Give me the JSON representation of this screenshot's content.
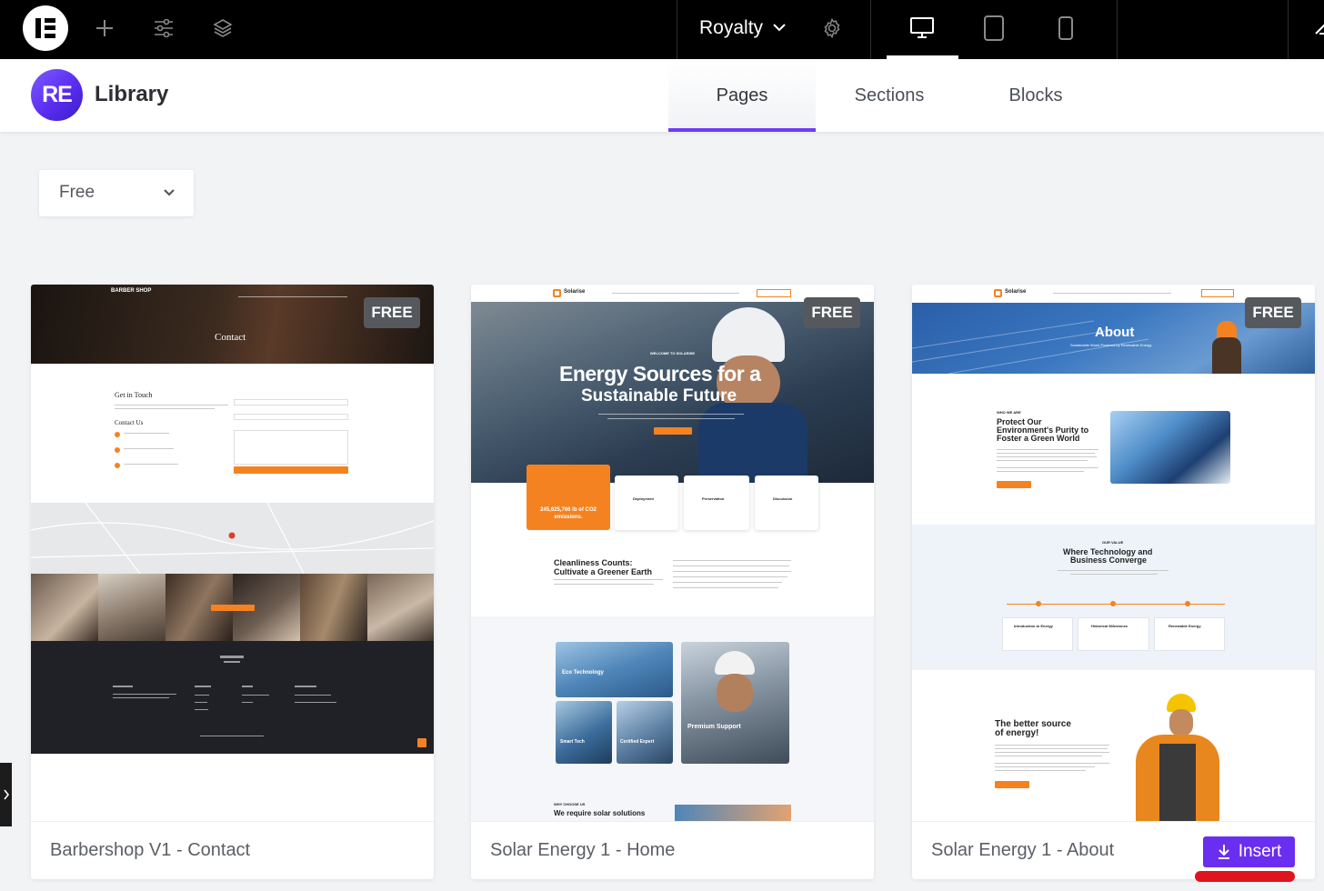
{
  "topbar": {
    "site_name": "Royalty",
    "icons": [
      "elementor-logo-icon",
      "add-icon",
      "settings-sliders-icon",
      "layers-icon",
      "gear-icon",
      "desktop-icon",
      "tablet-icon",
      "mobile-icon"
    ]
  },
  "library": {
    "logo_text": "RE",
    "title": "Library",
    "tabs": [
      {
        "label": "Pages",
        "active": true
      },
      {
        "label": "Sections",
        "active": false
      },
      {
        "label": "Blocks",
        "active": false
      }
    ],
    "filter": {
      "selected": "Free"
    }
  },
  "cards": [
    {
      "title": "Barbershop V1 - Contact",
      "badge": "FREE",
      "thumb": {
        "brand": "BARBER SHOP",
        "hero": "Contact",
        "get_in_touch": "Get in Touch",
        "contact_us": "Contact Us"
      }
    },
    {
      "title": "Solar Energy 1 - Home",
      "badge": "FREE",
      "thumb": {
        "brand": "Solarise",
        "welcome": "WELCOME TO SOLARISE",
        "hero_line1": "Energy Sources for a",
        "hero_line2": "Sustainable Future",
        "stat_text": "245,625,766 lb of CO2 emissions.",
        "features": [
          "Deployment",
          "Preservation",
          "Discussion"
        ],
        "clean_line1": "Cleanliness Counts:",
        "clean_line2": "Cultivate a Greener Earth",
        "eco": "Eco Technology",
        "smart": "Smart Tech",
        "certified": "Certified Expert",
        "premium": "Premium Support",
        "why": "WHY CHOOSE US",
        "require": "We require solar solutions"
      }
    },
    {
      "title": "Solar Energy 1 - About",
      "badge": "FREE",
      "insert_label": "Insert",
      "thumb": {
        "brand": "Solarise",
        "hero": "About",
        "hero_sub": "Sustainable World Powered by Renewable Energy",
        "who": "WHO WE ARE",
        "protect_line1": "Protect Our",
        "protect_line2": "Environment's Purity to",
        "protect_line3": "Foster a Green World",
        "our_value": "OUR VALUE",
        "where_line1": "Where Technology and",
        "where_line2": "Business Converge",
        "timeline": [
          "Introduction to Energy",
          "Historical Milestones",
          "Renewable Energy"
        ],
        "better_line1": "The better source",
        "better_line2": "of energy!"
      }
    }
  ]
}
